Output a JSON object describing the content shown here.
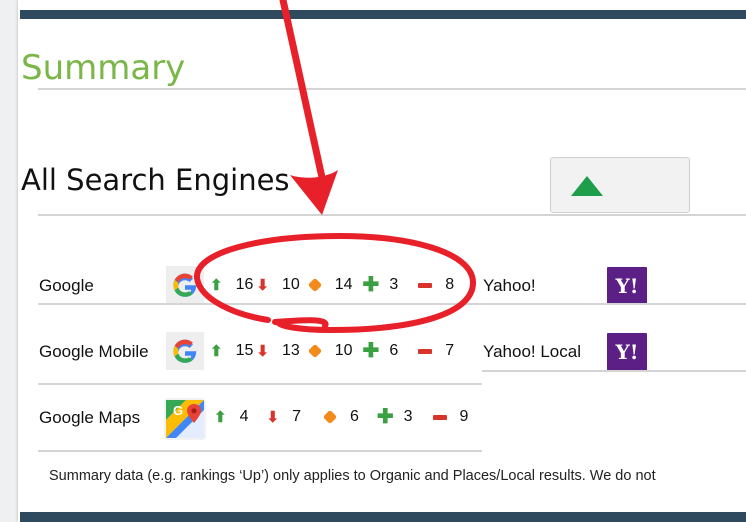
{
  "summary_title": "Summary",
  "section_title": "All Search Engines",
  "rows_left": [
    {
      "label": "Google",
      "up": "16",
      "down": "10",
      "same": "14",
      "added": "3",
      "removed": "8"
    },
    {
      "label": "Google Mobile",
      "up": "15",
      "down": "13",
      "same": "10",
      "added": "6",
      "removed": "7"
    },
    {
      "label": "Google Maps",
      "up": "4",
      "down": "7",
      "same": "6",
      "added": "3",
      "removed": "9"
    }
  ],
  "rows_right": [
    {
      "label": "Yahoo!",
      "logo": "Y!"
    },
    {
      "label": "Yahoo! Local",
      "logo": "Y!"
    }
  ],
  "footnote": "Summary data (e.g. rankings ‘Up’) only applies to Organic and Places/Local results. We do not",
  "icons": {
    "toggle": "triangle-up-icon",
    "up": "arrow-up-icon",
    "down": "arrow-down-icon",
    "same": "orange-dot-icon",
    "added": "plus-icon",
    "removed": "minus-icon"
  },
  "colors": {
    "summary": "#7ab648",
    "header_bar": "#2f4a5f",
    "up": "#3aa042",
    "down": "#d9342b",
    "same": "#f28a1c",
    "yahoo": "#5b1f86",
    "annotation": "#e8202a"
  }
}
